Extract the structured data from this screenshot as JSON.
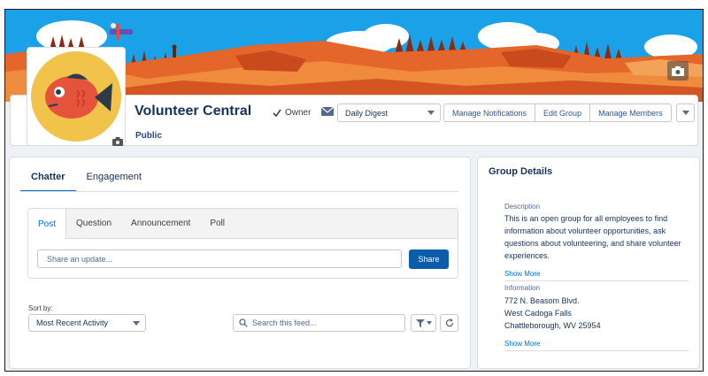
{
  "group": {
    "title": "Volunteer Central",
    "visibility": "Public",
    "owner_label": "Owner",
    "digest_value": "Daily Digest",
    "actions": [
      "Manage Notifications",
      "Edit Group",
      "Manage Members"
    ]
  },
  "feed": {
    "tabs": [
      "Chatter",
      "Engagement"
    ],
    "publisher_tabs": [
      "Post",
      "Question",
      "Announcement",
      "Poll"
    ],
    "share_placeholder": "Share an update...",
    "share_label": "Share",
    "sort_label": "Sort by:",
    "sort_value": "Most Recent Activity",
    "search_placeholder": "Search this feed..."
  },
  "details": {
    "title": "Group Details",
    "description_label": "Description",
    "description": "This is an open group for all employees to find information about volunteer opportunities, ask questions about volunteering, and share volunteer experiences.",
    "show_more_1": "Show More",
    "information_label": "Information",
    "address_line1": "772 N. Beasom Blvd.",
    "address_line2": "West Cadoga Falls",
    "address_line3": "Chattleborough, WV 25954",
    "show_more_2": "Show More"
  },
  "icons": {
    "owner": "checkmark-icon",
    "mail": "envelope-icon",
    "camera": "camera-icon",
    "filter": "filter-icon",
    "refresh": "refresh-icon",
    "search": "search-icon"
  },
  "colors": {
    "brand": "#0070d2",
    "share_button": "#0b5cab",
    "banner_sky": "#1aa1e8",
    "banner_rock": "#e5662b"
  }
}
